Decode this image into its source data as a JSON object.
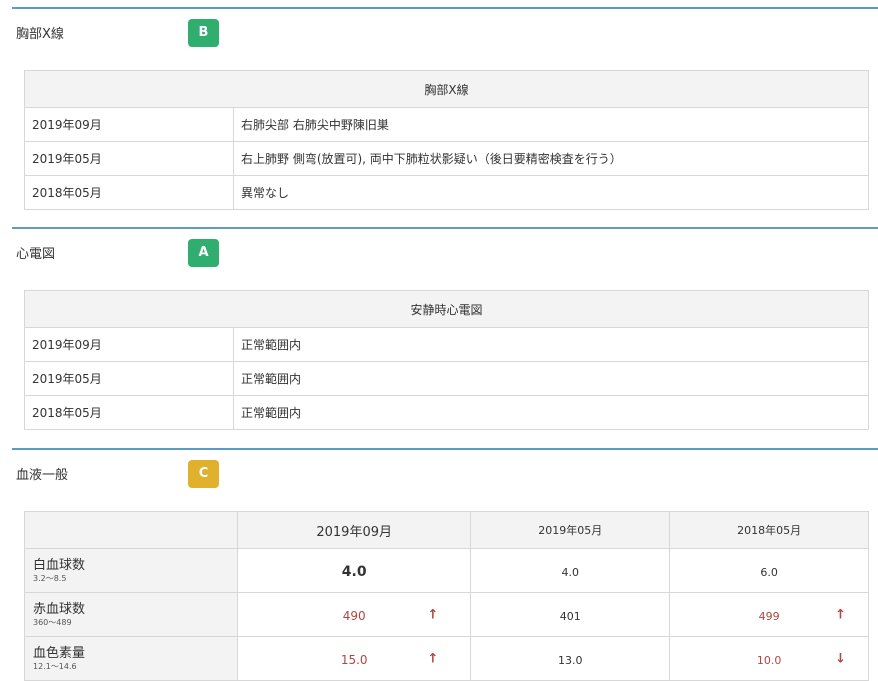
{
  "chest": {
    "title": "胸部X線",
    "grade": "B",
    "grade_color": "#2fae6f",
    "table_header": "胸部X線",
    "rows": [
      {
        "date": "2019年09月",
        "result": "右肺尖部 右肺尖中野陳旧巣"
      },
      {
        "date": "2019年05月",
        "result": "右上肺野 側弯(放置可), 両中下肺粒状影疑い（後日要精密検査を行う）"
      },
      {
        "date": "2018年05月",
        "result": "異常なし"
      }
    ]
  },
  "ecg": {
    "title": "心電図",
    "grade": "A",
    "grade_color": "#2fae6f",
    "table_header": "安静時心電図",
    "rows": [
      {
        "date": "2019年09月",
        "result": "正常範囲内"
      },
      {
        "date": "2019年05月",
        "result": "正常範囲内"
      },
      {
        "date": "2018年05月",
        "result": "正常範囲内"
      }
    ]
  },
  "blood": {
    "title": "血液一般",
    "grade": "C",
    "grade_color": "#e0b12c",
    "columns": [
      "2019年09月",
      "2019年05月",
      "2018年05月"
    ],
    "rows": [
      {
        "name": "白血球数",
        "range": "3.2〜8.5",
        "values": [
          "4.0",
          "4.0",
          "6.0"
        ],
        "flags": [
          "",
          "",
          ""
        ]
      },
      {
        "name": "赤血球数",
        "range": "360〜489",
        "values": [
          "490",
          "401",
          "499"
        ],
        "flags": [
          "up",
          "",
          "up"
        ]
      },
      {
        "name": "血色素量",
        "range": "12.1〜14.6",
        "values": [
          "15.0",
          "13.0",
          "10.0"
        ],
        "flags": [
          "up",
          "",
          "down"
        ]
      }
    ]
  },
  "icons": {
    "up": "↑",
    "down": "↓"
  },
  "colors": {
    "rule": "#5b9bc6",
    "abnormal": "#b0473f",
    "header_bg": "#f3f3f3"
  }
}
